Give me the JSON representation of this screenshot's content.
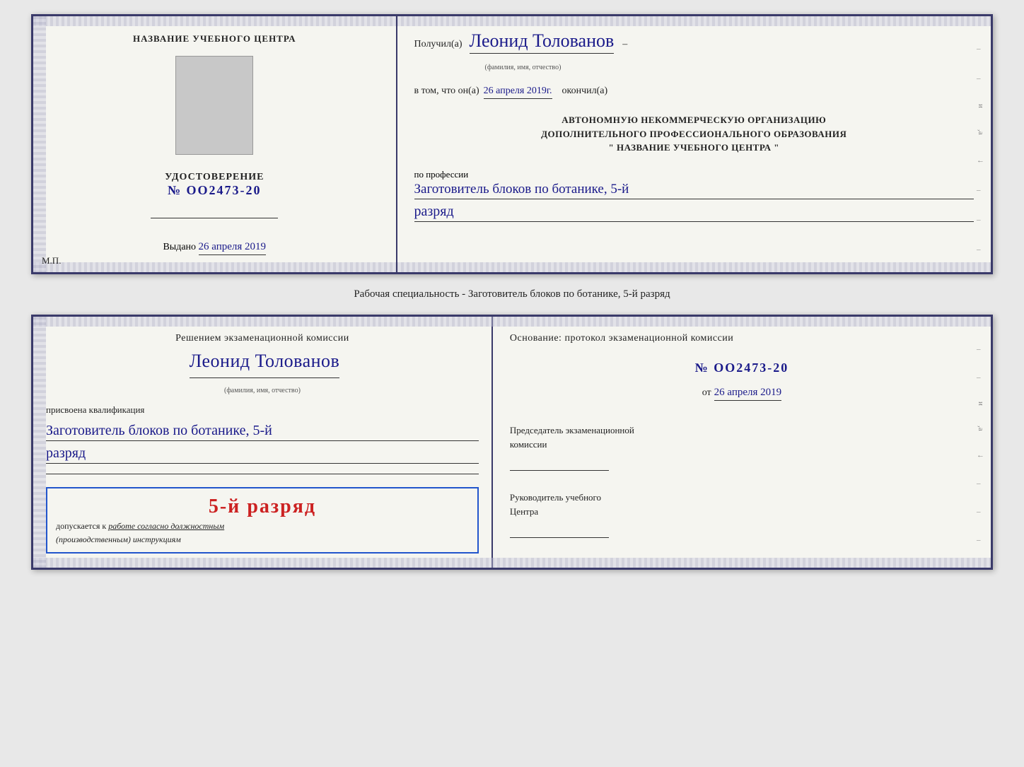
{
  "doc1": {
    "left": {
      "training_center_label": "НАЗВАНИЕ УЧЕБНОГО ЦЕНТРА",
      "cert_label": "УДОСТОВЕРЕНИЕ",
      "cert_number": "№ OO2473-20",
      "vydano_label": "Выдано",
      "vydano_date": "26 апреля 2019",
      "mp_label": "М.П."
    },
    "right": {
      "poluchil_label": "Получил(а)",
      "recipient_name": "Леонид Толованов",
      "fio_label": "(фамилия, имя, отчество)",
      "dash": "–",
      "vtom_label": "в том, что он(а)",
      "vtom_date": "26 апреля 2019г.",
      "okonchil_label": "окончил(а)",
      "org_line1": "АВТОНОМНУЮ НЕКОММЕРЧЕСКУЮ ОРГАНИЗАЦИЮ",
      "org_line2": "ДОПОЛНИТЕЛЬНОГО ПРОФЕССИОНАЛЬНОГО ОБРАЗОВАНИЯ",
      "org_line3": "\" НАЗВАНИЕ УЧЕБНОГО ЦЕНТРА \"",
      "po_professii_label": "по профессии",
      "profession_text": "Заготовитель блоков по ботанике, 5-й",
      "razryad_text": "разряд"
    }
  },
  "specialty_line": "Рабочая специальность - Заготовитель блоков по ботанике, 5-й разряд",
  "doc2": {
    "left": {
      "resheniem_label": "Решением экзаменационной комиссии",
      "name": "Леонид Толованов",
      "fio_label": "(фамилия, имя, отчество)",
      "prisvoena_label": "присвоена квалификация",
      "profession_text": "Заготовитель блоков по ботанике, 5-й",
      "razryad_text": "разряд",
      "stamp_rank": "5-й разряд",
      "dopuskaetsya_label": "допускается к",
      "rabote_text": "работе согласно должностным",
      "instruk_text": "(производственным) инструкциям"
    },
    "right": {
      "osnovanie_label": "Основание: протокол экзаменационной комиссии",
      "number": "№ OO2473-20",
      "ot_label": "от",
      "ot_date": "26 апреля 2019",
      "predsedatel_line1": "Председатель экзаменационной",
      "predsedatel_line2": "комиссии",
      "rukov_line1": "Руководитель учебного",
      "rukov_line2": "Центра"
    }
  }
}
